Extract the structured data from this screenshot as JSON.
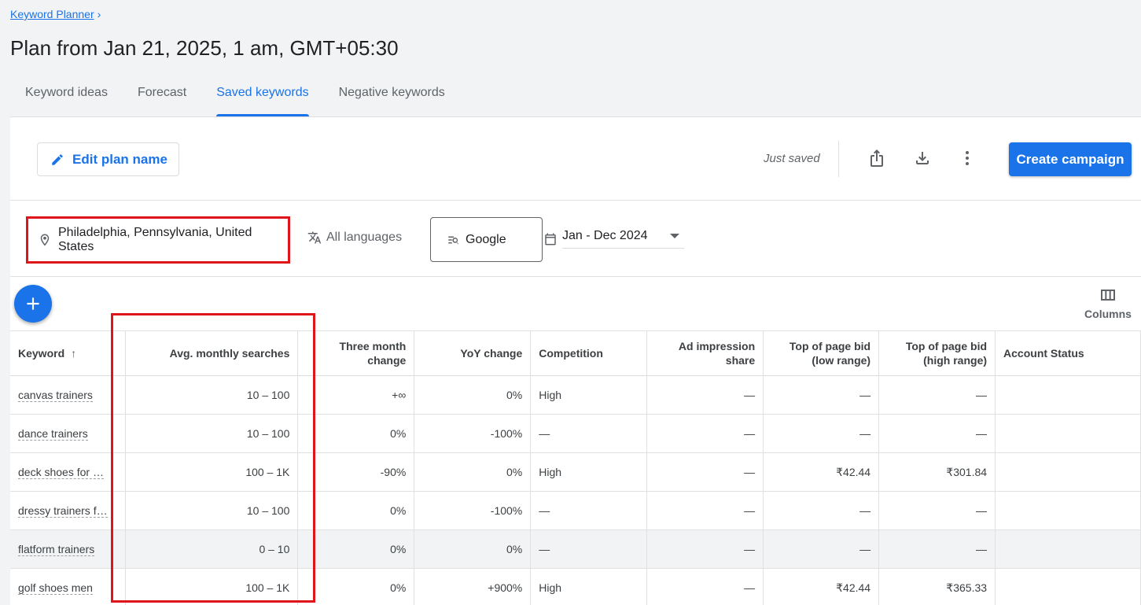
{
  "breadcrumb": {
    "label": "Keyword Planner",
    "chevron": "›"
  },
  "page_title": "Plan from Jan 21, 2025, 1 am, GMT+05:30",
  "tabs": [
    {
      "label": "Keyword ideas",
      "active": false
    },
    {
      "label": "Forecast",
      "active": false
    },
    {
      "label": "Saved keywords",
      "active": true
    },
    {
      "label": "Negative keywords",
      "active": false
    }
  ],
  "toolbar": {
    "edit_plan_label": "Edit plan name",
    "saved_status": "Just saved",
    "create_campaign_label": "Create campaign",
    "icons": [
      "share-icon",
      "download-icon",
      "more-vert-icon"
    ]
  },
  "filters": {
    "location": "Philadelphia, Pennsylvania, United States",
    "language": "All languages",
    "network": "Google",
    "date_range": "Jan - Dec 2024"
  },
  "columns_label": "Columns",
  "table": {
    "headers": {
      "keyword": "Keyword",
      "sort_arrow": "↑",
      "avg_searches": "Avg. monthly searches",
      "three_month_1": "Three month",
      "three_month_2": "change",
      "yoy": "YoY change",
      "competition": "Competition",
      "ad_share_1": "Ad impression",
      "ad_share_2": "share",
      "bid_low_1": "Top of page bid",
      "bid_low_2": "(low range)",
      "bid_high_1": "Top of page bid",
      "bid_high_2": "(high range)",
      "account_status": "Account Status"
    },
    "rows": [
      {
        "keyword": "canvas trainers",
        "avg": "10 – 100",
        "three": "+∞",
        "yoy": "0%",
        "comp": "High",
        "share": "—",
        "low": "—",
        "high": "—",
        "status": ""
      },
      {
        "keyword": "dance trainers",
        "avg": "10 – 100",
        "three": "0%",
        "yoy": "-100%",
        "comp": "—",
        "share": "—",
        "low": "—",
        "high": "—",
        "status": ""
      },
      {
        "keyword": "deck shoes for …",
        "avg": "100 – 1K",
        "three": "-90%",
        "yoy": "0%",
        "comp": "High",
        "share": "—",
        "low": "₹42.44",
        "high": "₹301.84",
        "status": ""
      },
      {
        "keyword": "dressy trainers f…",
        "avg": "10 – 100",
        "three": "0%",
        "yoy": "-100%",
        "comp": "—",
        "share": "—",
        "low": "—",
        "high": "—",
        "status": ""
      },
      {
        "keyword": "flatform trainers",
        "avg": "0 – 10",
        "three": "0%",
        "yoy": "0%",
        "comp": "—",
        "share": "—",
        "low": "—",
        "high": "—",
        "status": ""
      },
      {
        "keyword": "golf shoes men",
        "avg": "100 – 1K",
        "three": "0%",
        "yoy": "+900%",
        "comp": "High",
        "share": "—",
        "low": "₹42.44",
        "high": "₹365.33",
        "status": ""
      }
    ]
  }
}
